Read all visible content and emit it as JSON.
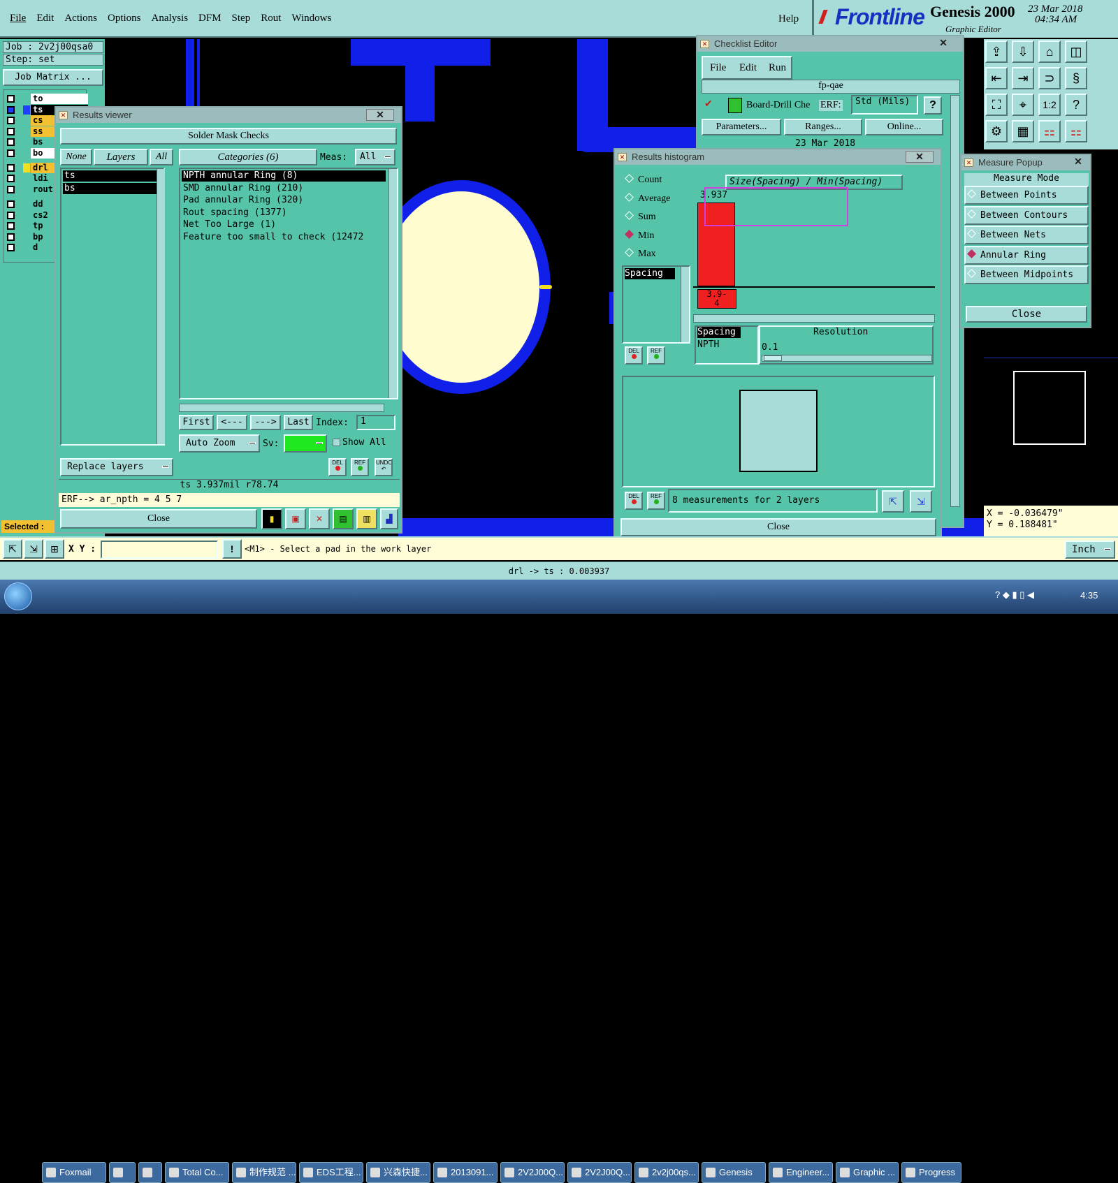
{
  "menu": {
    "items": [
      "File",
      "Edit",
      "Actions",
      "Options",
      "Analysis",
      "DFM",
      "Step",
      "Rout",
      "Windows"
    ],
    "help": "Help",
    "brand": "Frontline",
    "product": "Genesis 2000",
    "subtitle": "Graphic Editor",
    "date": "23 Mar 2018",
    "time": "04:34 AM"
  },
  "job": {
    "job_label": "Job : 2v2j00qsa0",
    "step_label": "Step: set",
    "matrix_button": "Job Matrix ..."
  },
  "layers": [
    {
      "name": "to",
      "color": "#ffffff"
    },
    {
      "name": "ts",
      "color": "#000000"
    },
    {
      "name": "cs",
      "color": "#f2c030"
    },
    {
      "name": "ss",
      "color": "#f2c030"
    },
    {
      "name": "bs",
      "color": "#55c4a8"
    },
    {
      "name": "bo",
      "color": "#ffffff"
    },
    {
      "name": "drl",
      "color": "#f2c030"
    },
    {
      "name": "ldi",
      "color": "#55c4a8"
    },
    {
      "name": "rout",
      "color": "#55c4a8"
    },
    {
      "name": "dd",
      "color": "#55c4a8"
    },
    {
      "name": "cs2",
      "color": "#55c4a8"
    },
    {
      "name": "tp",
      "color": "#55c4a8"
    },
    {
      "name": "bp",
      "color": "#55c4a8"
    },
    {
      "name": "d",
      "color": "#55c4a8"
    }
  ],
  "selected_label": "Selected :",
  "results_viewer": {
    "title": "Results viewer",
    "heading": "Solder Mask Checks",
    "none": "None",
    "layers": "Layers",
    "all": "All",
    "categories": "Categories (6)",
    "meas_label": "Meas:",
    "meas_value": "All",
    "layer_items": [
      "ts",
      "bs"
    ],
    "category_items": [
      "NPTH annular Ring (8)",
      "SMD annular Ring (210)",
      "Pad annular Ring (320)",
      "Rout spacing (1377)",
      "Net Too Large (1)",
      "Feature too small to check (12472"
    ],
    "nav": {
      "first": "First",
      "prev": "<---",
      "next": "--->",
      "last": "Last",
      "index_label": "Index:",
      "index_value": "1"
    },
    "auto_zoom": "Auto Zoom",
    "sv_label": "Sv:",
    "show_all": "Show All",
    "replace_layers": "Replace layers",
    "del": "DEL",
    "ref": "REF",
    "undo": "UNDO",
    "status": "ts 3.937mil  r78.74",
    "erf": "ERF--> ar_npth = 4 5 7",
    "close": "Close"
  },
  "checklist_editor": {
    "title": "Checklist Editor",
    "menu": [
      "File",
      "Edit",
      "Run"
    ],
    "name": "fp-qae",
    "action": "Board-Drill Che",
    "erf_label": "ERF:",
    "erf_value": "Std (Mils)",
    "help": "?",
    "buttons": [
      "Parameters...",
      "Ranges...",
      "Online..."
    ],
    "date": "23 Mar 2018"
  },
  "histogram": {
    "title": "Results histogram",
    "modes": [
      {
        "label": "Count",
        "on": false
      },
      {
        "label": "Average",
        "on": false
      },
      {
        "label": "Sum",
        "on": false
      },
      {
        "label": "Min",
        "on": true
      },
      {
        "label": "Max",
        "on": false
      }
    ],
    "header": "Size(Spacing) / Min(Spacing)",
    "bar_value": "3.937",
    "bar_label": "3.9-\n4",
    "list": [
      "Spacing"
    ],
    "spacing_list": [
      "Spacing",
      "NPTH"
    ],
    "resolution_label": "Resolution",
    "resolution_value": "0.1",
    "measurements": "8 measurements for 2 layers",
    "close": "Close",
    "del": "DEL",
    "ref": "REF"
  },
  "measure_popup": {
    "title": "Measure Popup",
    "mode_label": "Measure Mode",
    "modes": [
      {
        "label": "Between Points",
        "on": false
      },
      {
        "label": "Between Contours",
        "on": false
      },
      {
        "label": "Between Nets",
        "on": false
      },
      {
        "label": "Annular Ring",
        "on": true
      },
      {
        "label": "Between Midpoints",
        "on": false
      }
    ],
    "close": "Close"
  },
  "coords": {
    "x": "X = -0.036479\"",
    "y": "Y = 0.188481\""
  },
  "bottom": {
    "xy_label": "X Y :",
    "prompt": "<M1> - Select a pad in the work layer",
    "unit": "Inch",
    "status": "drl -> ts : 0.003937"
  },
  "taskbar": {
    "items": [
      "Foxmail",
      "",
      "",
      "Total Co...",
      "制作规范 ...",
      "EDS工程...",
      "兴森快捷...",
      "2013091...",
      "2V2J00Q...",
      "2V2J00Q...",
      "2v2j00qs...",
      "Genesis",
      "Engineer...",
      "Graphic ...",
      "Progress"
    ],
    "clock": "4:35"
  }
}
